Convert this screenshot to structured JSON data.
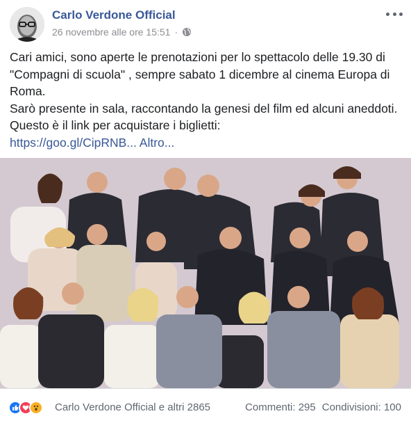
{
  "post": {
    "author": "Carlo Verdone Official",
    "timestamp": "26 novembre alle ore 15:51",
    "separator": "·",
    "privacy_icon": "globe-icon",
    "more_icon": "more-options-icon",
    "text_lines": [
      "Cari amici, sono aperte le prenotazioni per lo spettacolo delle 19.30 di \"Compagni di scuola\" , sempre sabato 1 dicembre al cinema Europa di Roma.",
      "Sarò presente in sala, raccontando la genesi del film ed alcuni aneddoti.",
      "Questo è il link per acquistare i biglietti:"
    ],
    "link": "https://goo.gl/CipRNB...",
    "see_more": "Altro..."
  },
  "photo": {
    "description": "cast-group-photo"
  },
  "footer": {
    "reaction_icons": [
      "like-icon",
      "love-icon",
      "wow-icon"
    ],
    "reactors": "Carlo Verdone Official e altri 2865",
    "comments": "Commenti: 295",
    "shares": "Condivisioni: 100"
  },
  "colors": {
    "link": "#385898",
    "secondary_text": "#606770",
    "like": "#1877f2",
    "love": "#f33e58",
    "wow": "#f7b125"
  }
}
